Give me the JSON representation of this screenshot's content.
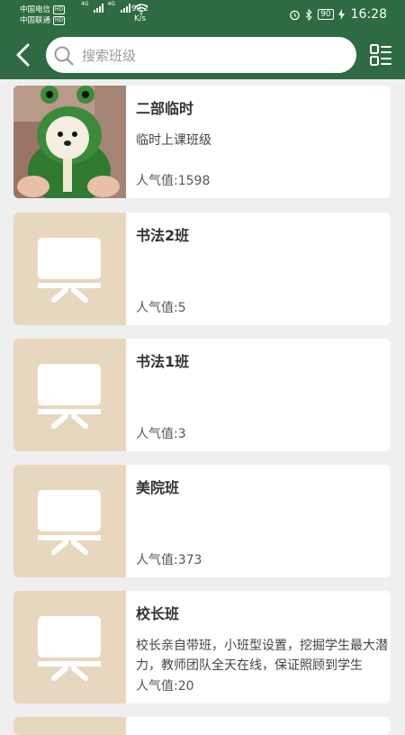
{
  "status_bar": {
    "carrier1": "中国电信",
    "carrier2": "中国联通",
    "badge": "HD",
    "net": "4G",
    "speed_value": "90.2",
    "speed_unit": "K/s",
    "battery": "90",
    "time": "16:28"
  },
  "header": {
    "search_placeholder": "搜索班级"
  },
  "classes": [
    {
      "title": "二部临时",
      "desc": "临时上课班级",
      "popularity": "人气值:1598",
      "thumb": "photo"
    },
    {
      "title": "书法2班",
      "desc": "",
      "popularity": "人气值:5",
      "thumb": "board-icon"
    },
    {
      "title": "书法1班",
      "desc": "",
      "popularity": "人气值:3",
      "thumb": "board-icon"
    },
    {
      "title": "美院班",
      "desc": "",
      "popularity": "人气值:373",
      "thumb": "board-icon"
    },
    {
      "title": "校长班",
      "desc": "校长亲自带班，小班型设置，挖掘学生最大潜力，教师团队全天在线，保证照顾到学生",
      "popularity": "人气值:20",
      "thumb": "board-icon"
    }
  ],
  "colors": {
    "header": "#2e6b43",
    "thumb_bg": "#e7d7bf",
    "page_bg": "#efefef"
  }
}
